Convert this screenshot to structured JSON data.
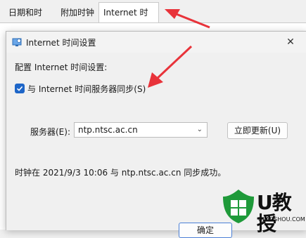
{
  "tabs": [
    "日期和时间",
    "附加时钟",
    "Internet 时间"
  ],
  "dialog": {
    "title": "Internet 时间设置",
    "close_glyph": "✕",
    "section_label": "配置 Internet 时间设置:",
    "sync_label": "与 Internet 时间服务器同步(S)",
    "sync_checked": true,
    "server_label": "服务器(E):",
    "server_value": "ntp.ntsc.ac.cn",
    "update_button": "立即更新(U)",
    "status_text": "时钟在 2021/9/3 10:06 与 ntp.ntsc.ac.cn 同步成功。",
    "ok_button": "确定"
  },
  "watermark": {
    "brand": "U教授",
    "url": "UJIAOSHOU.COM"
  },
  "colors": {
    "accent": "#1e66c8",
    "arrow": "#e8333a"
  }
}
